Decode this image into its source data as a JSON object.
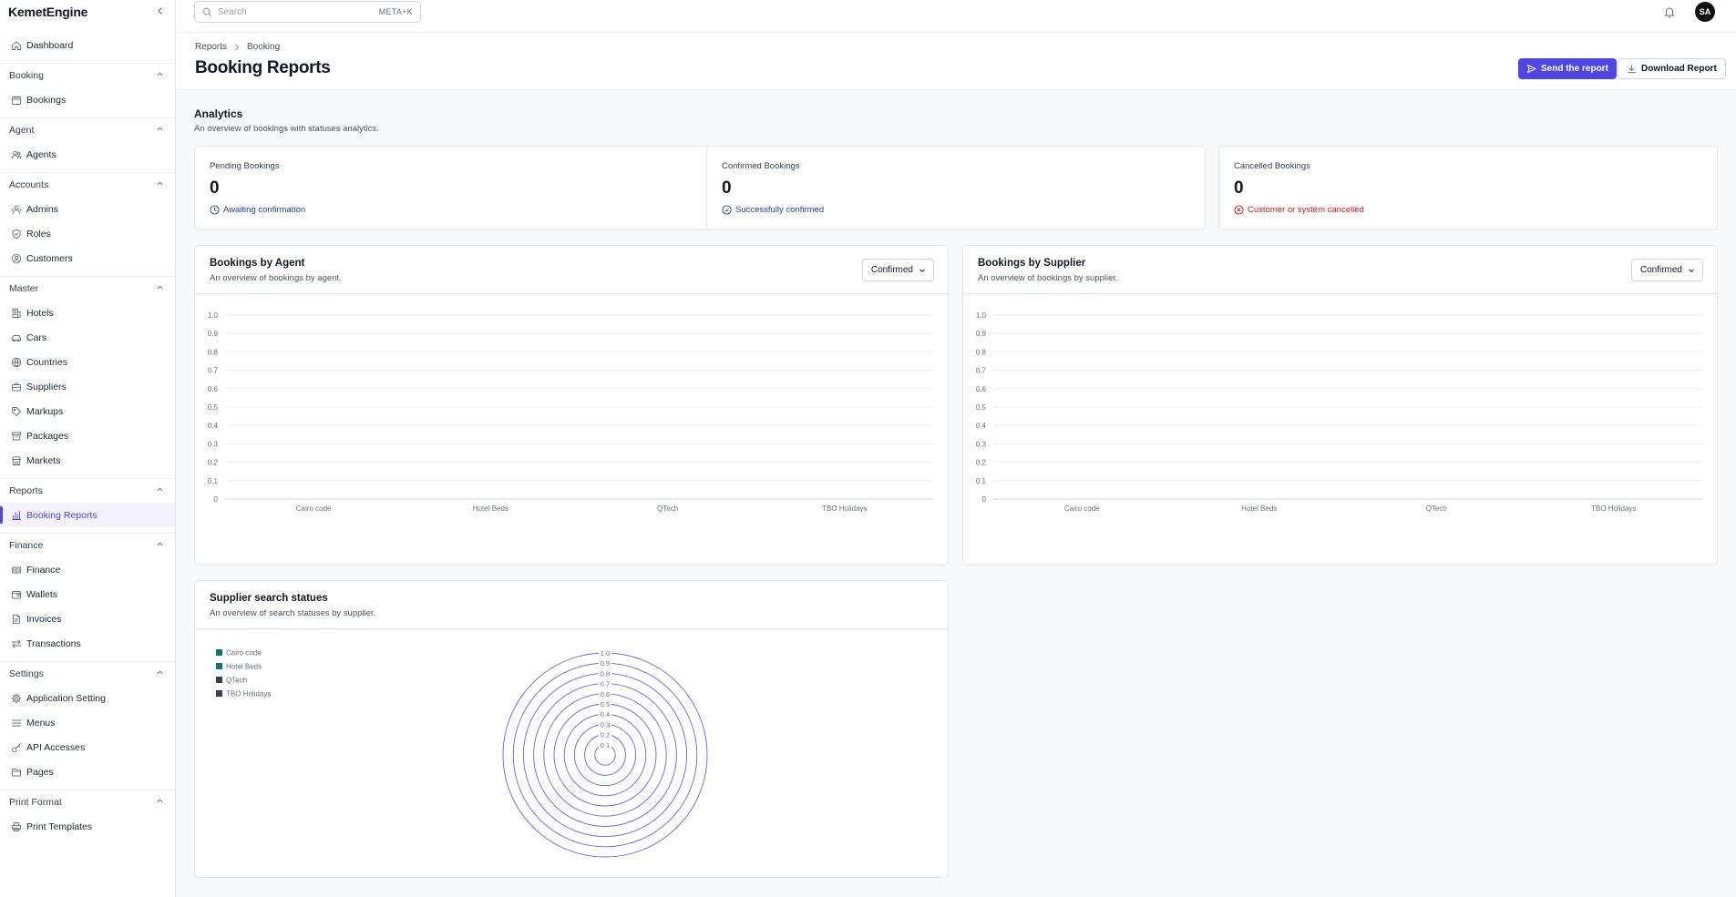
{
  "app": {
    "brand": "KemetEngine"
  },
  "sidebar": {
    "top_item": {
      "label": "Dashboard",
      "icon": "home-icon"
    },
    "sections": [
      {
        "title": "Booking",
        "items": [
          {
            "label": "Bookings",
            "icon": "calendar-icon"
          }
        ]
      },
      {
        "title": "Agent",
        "items": [
          {
            "label": "Agents",
            "icon": "users-icon"
          }
        ]
      },
      {
        "title": "Accounts",
        "items": [
          {
            "label": "Admins",
            "icon": "user-group-icon"
          },
          {
            "label": "Roles",
            "icon": "shield-icon"
          },
          {
            "label": "Customers",
            "icon": "user-circle-icon"
          }
        ]
      },
      {
        "title": "Master",
        "items": [
          {
            "label": "Hotels",
            "icon": "building-icon"
          },
          {
            "label": "Cars",
            "icon": "car-icon"
          },
          {
            "label": "Countries",
            "icon": "globe-icon"
          },
          {
            "label": "Suppliers",
            "icon": "briefcase-icon"
          },
          {
            "label": "Markups",
            "icon": "tag-icon"
          },
          {
            "label": "Packages",
            "icon": "package-icon"
          },
          {
            "label": "Markets",
            "icon": "store-icon"
          }
        ]
      },
      {
        "title": "Reports",
        "items": [
          {
            "label": "Booking Reports",
            "icon": "bar-chart-icon",
            "active": true
          }
        ]
      },
      {
        "title": "Finance",
        "items": [
          {
            "label": "Finance",
            "icon": "money-icon"
          },
          {
            "label": "Wallets",
            "icon": "wallet-icon"
          },
          {
            "label": "Invoices",
            "icon": "document-icon"
          },
          {
            "label": "Transactions",
            "icon": "arrows-icon"
          }
        ]
      },
      {
        "title": "Settings",
        "items": [
          {
            "label": "Application Setting",
            "icon": "gear-icon"
          },
          {
            "label": "Menus",
            "icon": "menu-icon"
          },
          {
            "label": "API Accesses",
            "icon": "key-icon"
          },
          {
            "label": "Pages",
            "icon": "folder-icon"
          }
        ]
      },
      {
        "title": "Print Format",
        "items": [
          {
            "label": "Print Templates",
            "icon": "printer-icon"
          }
        ]
      }
    ]
  },
  "topbar": {
    "search_placeholder": "Search",
    "shortcut": "META+K",
    "avatar_initials": "SA"
  },
  "header": {
    "breadcrumb": [
      "Reports",
      "Booking"
    ],
    "title": "Booking Reports",
    "send_label": "Send the report",
    "download_label": "Download Report"
  },
  "analytics": {
    "title": "Analytics",
    "subtitle": "An overview of bookings with statuses analytics.",
    "cards": [
      {
        "label": "Pending Bookings",
        "value": "0",
        "note": "Awaiting confirmation",
        "tone": "blue",
        "icon": "clock-icon"
      },
      {
        "label": "Confirmed Bookings",
        "value": "0",
        "note": "Successfully confirmed",
        "tone": "blue",
        "icon": "check-circle-icon"
      },
      {
        "label": "Cancelled Bookings",
        "value": "0",
        "note": "Customer or system cancelled",
        "tone": "red",
        "icon": "x-circle-icon"
      }
    ]
  },
  "charts": {
    "agent": {
      "title": "Bookings by Agent",
      "subtitle": "An overview of bookings by agent.",
      "filter": "Confirmed"
    },
    "supplier": {
      "title": "Bookings by Supplier",
      "subtitle": "An overview of bookings by supplier.",
      "filter": "Confirmed"
    },
    "search": {
      "title": "Supplier search statues",
      "subtitle": "An overview of search statuses by supplier."
    }
  },
  "chart_data": [
    {
      "type": "bar",
      "categories": [
        "Cairo code",
        "Hotel Beds",
        "QTech",
        "TBO Holidays"
      ],
      "values": [
        0,
        0,
        0,
        0
      ],
      "yticks": [
        "0",
        "0.1",
        "0.2",
        "0.3",
        "0.4",
        "0.5",
        "0.6",
        "0.7",
        "0.8",
        "0.9",
        "1.0"
      ],
      "ylim": [
        0,
        1
      ],
      "grid": true
    },
    {
      "type": "bar",
      "categories": [
        "Cairo code",
        "Hotel Beds",
        "QTech",
        "TBO Holidays"
      ],
      "values": [
        0,
        0,
        0,
        0
      ],
      "yticks": [
        "0",
        "0.1",
        "0.2",
        "0.3",
        "0.4",
        "0.5",
        "0.6",
        "0.7",
        "0.8",
        "0.9",
        "1.0"
      ],
      "ylim": [
        0,
        1
      ],
      "grid": true
    },
    {
      "type": "polar",
      "series": [
        {
          "name": "Cairo code",
          "value": 0,
          "color": "#0f766e"
        },
        {
          "name": "Hotel Beds",
          "value": 0,
          "color": "#0f766e"
        },
        {
          "name": "QTech",
          "value": 0,
          "color": "#374151"
        },
        {
          "name": "TBO Holidays",
          "value": 0,
          "color": "#374151"
        }
      ],
      "rticks": [
        "0.1",
        "0.2",
        "0.3",
        "0.4",
        "0.5",
        "0.6",
        "0.7",
        "0.8",
        "0.9",
        "1.0"
      ],
      "rlim": [
        0,
        1
      ],
      "ring_color": "#6366f1",
      "legend": "top-left"
    }
  ],
  "colors": {
    "accent": "#4f46e5",
    "info": "#1e40af",
    "danger": "#b91c1c"
  }
}
